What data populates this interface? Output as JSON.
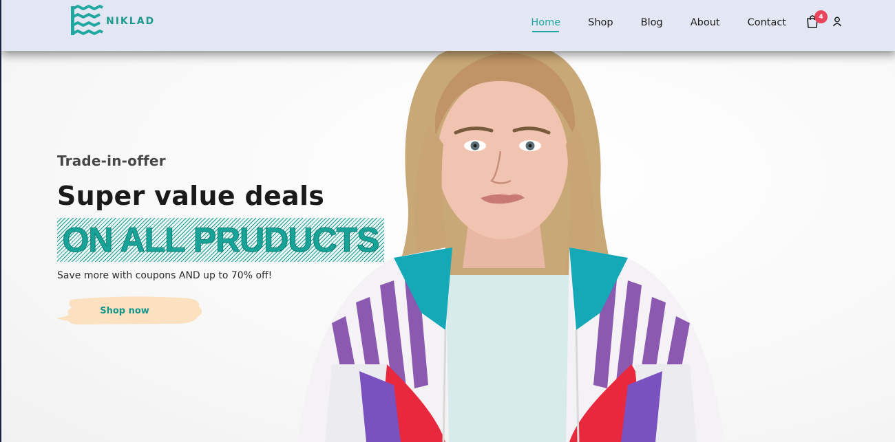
{
  "brand": {
    "name": "NIKLAD",
    "color": "#1c9a8e"
  },
  "nav": {
    "items": [
      {
        "label": "Home",
        "active": true
      },
      {
        "label": "Shop",
        "active": false
      },
      {
        "label": "Blog",
        "active": false
      },
      {
        "label": "About",
        "active": false
      },
      {
        "label": "Contact",
        "active": false
      }
    ],
    "cart_icon": "shopping-bag-icon",
    "cart_count": "4",
    "user_icon": "user-icon"
  },
  "hero": {
    "tag": "Trade-in-offer",
    "headline": "Super value deals",
    "highlight": "ON ALL PRUDUCTS",
    "subtext": "Save more with coupons AND up to 70% off!",
    "button_label": "Shop now"
  },
  "colors": {
    "accent": "#20a8a0",
    "header_bg": "#e3e6f3",
    "badge": "#e8455c",
    "button_bg": "#fbe1c0"
  }
}
